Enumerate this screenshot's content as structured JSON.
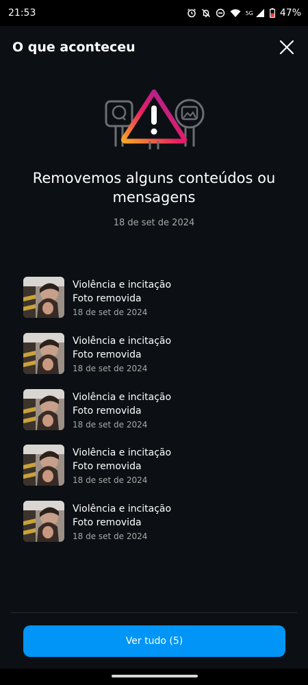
{
  "status_bar": {
    "time": "21:53",
    "network": "5G",
    "battery": "47%",
    "icons": [
      "alarm-icon",
      "notifications-off-icon",
      "do-not-disturb-icon",
      "wifi-icon",
      "signal-icon",
      "battery-icon"
    ]
  },
  "header": {
    "title": "O que aconteceu",
    "close_icon": "close-icon"
  },
  "hero": {
    "title": "Removemos alguns conteúdos ou mensagens",
    "date": "18 de set de 2024",
    "illustration": "warning-sign-icon"
  },
  "items": [
    {
      "reason": "Violência e incitação",
      "action": "Foto removida",
      "date": "18 de set de 2024"
    },
    {
      "reason": "Violência e incitação",
      "action": "Foto removida",
      "date": "18 de set de 2024"
    },
    {
      "reason": "Violência e incitação",
      "action": "Foto removida",
      "date": "18 de set de 2024"
    },
    {
      "reason": "Violência e incitação",
      "action": "Foto removida",
      "date": "18 de set de 2024"
    },
    {
      "reason": "Violência e incitação",
      "action": "Foto removida",
      "date": "18 de set de 2024"
    }
  ],
  "footer": {
    "button_label": "Ver tudo (5)"
  },
  "colors": {
    "background": "#0c1014",
    "primary": "#0095f6",
    "secondary_text": "#a8a8a8",
    "gradient": [
      "#f9a825",
      "#e91e63",
      "#7b1fa2"
    ]
  }
}
